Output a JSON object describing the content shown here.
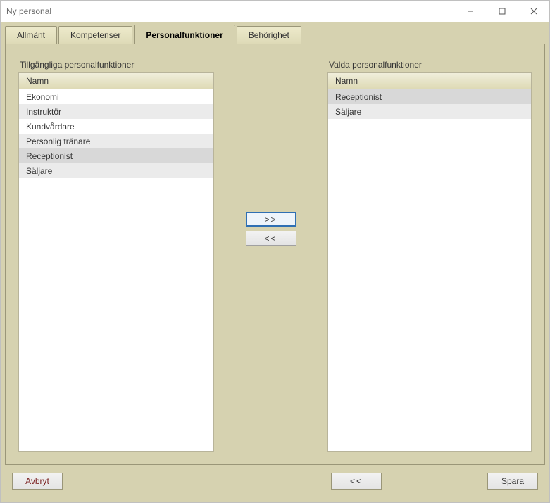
{
  "window": {
    "title": "Ny personal"
  },
  "tabs": {
    "general": "Allmänt",
    "competences": "Kompetenser",
    "functions": "Personalfunktioner",
    "permissions": "Behörighet"
  },
  "panel": {
    "available_title": "Tillgängliga personalfunktioner",
    "selected_title": "Valda personalfunktioner",
    "column_header": "Namn",
    "available": [
      "Ekonomi",
      "Instruktör",
      "Kundvårdare",
      "Personlig tränare",
      "Receptionist",
      "Säljare"
    ],
    "selected": [
      "Receptionist",
      "Säljare"
    ]
  },
  "transfer": {
    "add": ">>",
    "remove": "<<"
  },
  "footer": {
    "cancel": "Avbryt",
    "back": "<<",
    "save": "Spara"
  }
}
